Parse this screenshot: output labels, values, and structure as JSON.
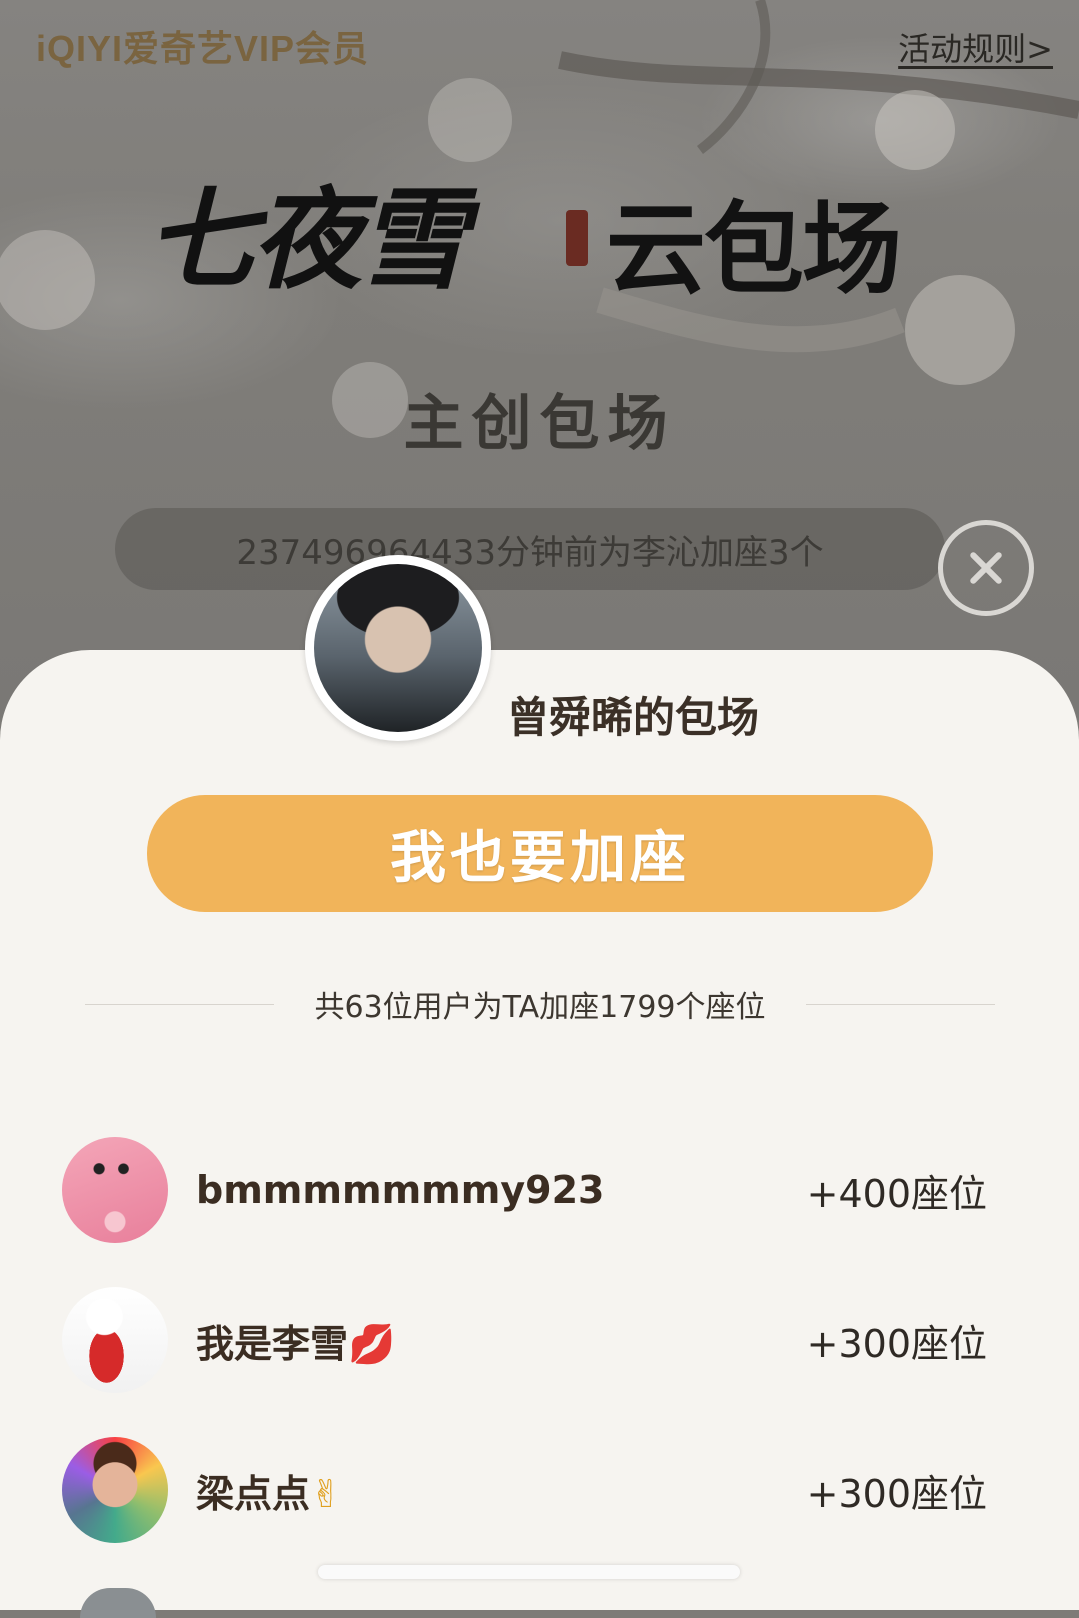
{
  "brand": "iQIYI爱奇艺VIP会员",
  "rules_link": "活动规则>",
  "hero": {
    "title": "七夜雪",
    "subtitle": "云包场"
  },
  "section_title": "主创包场",
  "ticker_text": "237496964433分钟前为李沁加座3个",
  "sheet": {
    "title": "曾舜晞的包场",
    "cta_label": "我也要加座",
    "summary": "共63位用户为TA加座1799个座位",
    "supporters": [
      {
        "name": "bmmmmmmmy923",
        "emoji": "",
        "seats": "+400座位"
      },
      {
        "name": "我是李雪",
        "emoji": "💋",
        "seats": "+300座位"
      },
      {
        "name": "梁点点",
        "emoji": "✌",
        "seats": "+300座位"
      }
    ]
  },
  "colors": {
    "accent_button": "#f1b45a",
    "sheet_background": "#f6f4f0",
    "overlay_background": "#7d7b77"
  }
}
